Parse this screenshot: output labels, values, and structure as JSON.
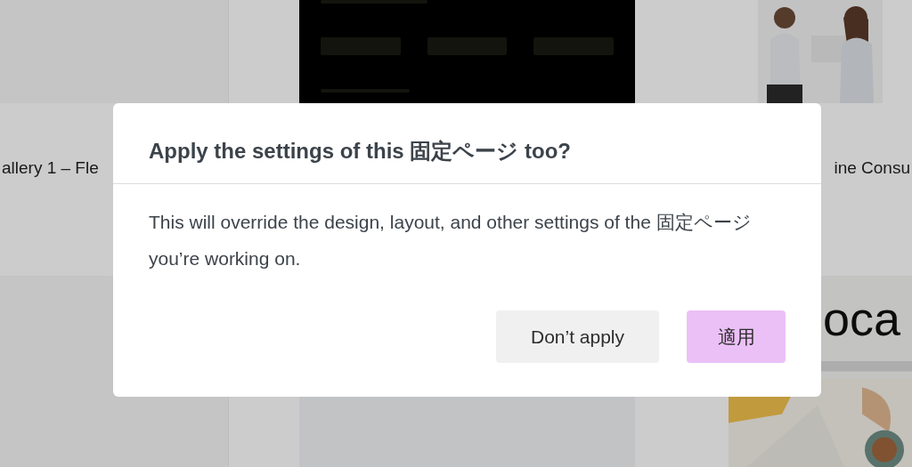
{
  "background": {
    "cards": [
      {
        "title": "allery 1 – Fle"
      },
      {
        "title": "ine Consu"
      }
    ],
    "logo_text": "oca"
  },
  "dialog": {
    "title": "Apply the settings of this 固定ページ too?",
    "message": "This will override the design, layout, and other settings of the 固定ページ you’re working on.",
    "buttons": [
      {
        "label": "Don’t apply",
        "kind": "secondary"
      },
      {
        "label": "適用",
        "kind": "primary"
      }
    ]
  }
}
